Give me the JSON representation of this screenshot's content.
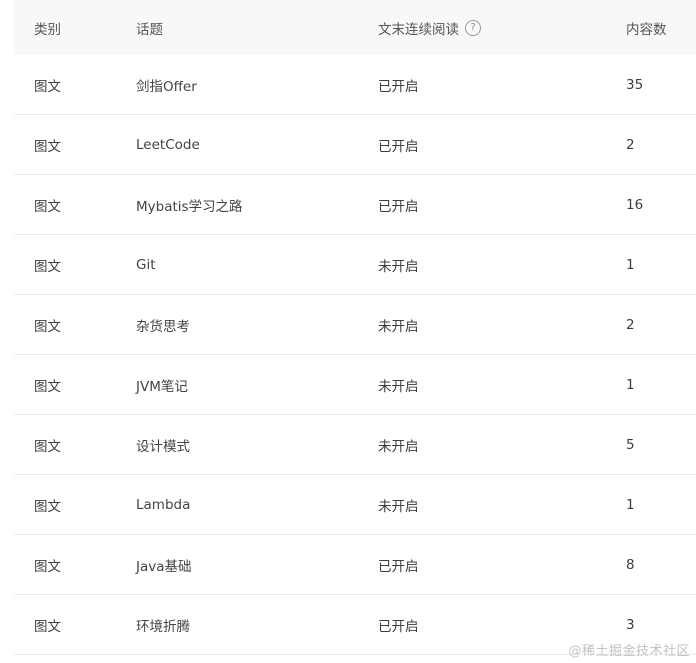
{
  "table": {
    "headers": {
      "category": "类别",
      "topic": "话题",
      "continuous_reading": "文末连续阅读",
      "help_icon": "question-circle",
      "count": "内容数"
    },
    "rows": [
      {
        "category": "图文",
        "topic": "剑指Offer",
        "status": "已开启",
        "count": "35"
      },
      {
        "category": "图文",
        "topic": "LeetCode",
        "status": "已开启",
        "count": "2"
      },
      {
        "category": "图文",
        "topic": "Mybatis学习之路",
        "status": "已开启",
        "count": "16"
      },
      {
        "category": "图文",
        "topic": "Git",
        "status": "未开启",
        "count": "1"
      },
      {
        "category": "图文",
        "topic": "杂货思考",
        "status": "未开启",
        "count": "2"
      },
      {
        "category": "图文",
        "topic": "JVM笔记",
        "status": "未开启",
        "count": "1"
      },
      {
        "category": "图文",
        "topic": "设计模式",
        "status": "未开启",
        "count": "5"
      },
      {
        "category": "图文",
        "topic": "Lambda",
        "status": "未开启",
        "count": "1"
      },
      {
        "category": "图文",
        "topic": "Java基础",
        "status": "已开启",
        "count": "8"
      },
      {
        "category": "图文",
        "topic": "环境折腾",
        "status": "已开启",
        "count": "3"
      }
    ]
  },
  "watermark": "@稀土掘金技术社区"
}
